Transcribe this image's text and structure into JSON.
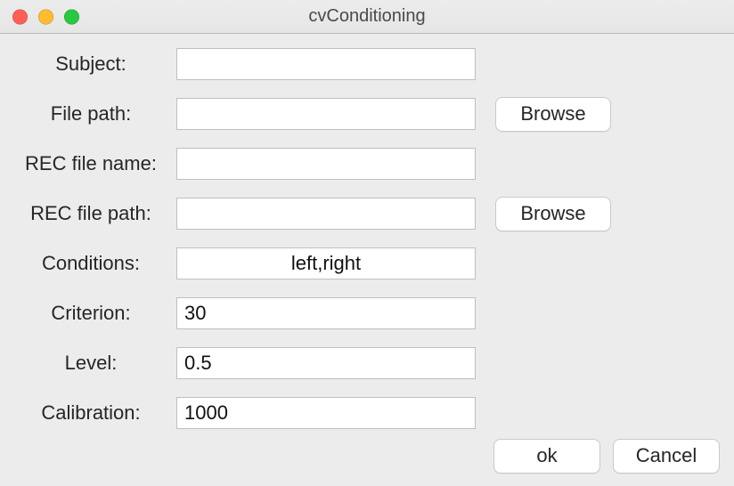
{
  "window": {
    "title": "cvConditioning"
  },
  "form": {
    "subject": {
      "label": "Subject:",
      "value": ""
    },
    "file_path": {
      "label": "File path:",
      "value": "",
      "browse_label": "Browse"
    },
    "rec_file_name": {
      "label": "REC file name:",
      "value": ""
    },
    "rec_file_path": {
      "label": "REC file path:",
      "value": "",
      "browse_label": "Browse"
    },
    "conditions": {
      "label": "Conditions:",
      "value": "left,right"
    },
    "criterion": {
      "label": "Criterion:",
      "value": "30"
    },
    "level": {
      "label": "Level:",
      "value": "0.5"
    },
    "calibration": {
      "label": "Calibration:",
      "value": "1000"
    }
  },
  "footer": {
    "ok_label": "ok",
    "cancel_label": "Cancel"
  }
}
